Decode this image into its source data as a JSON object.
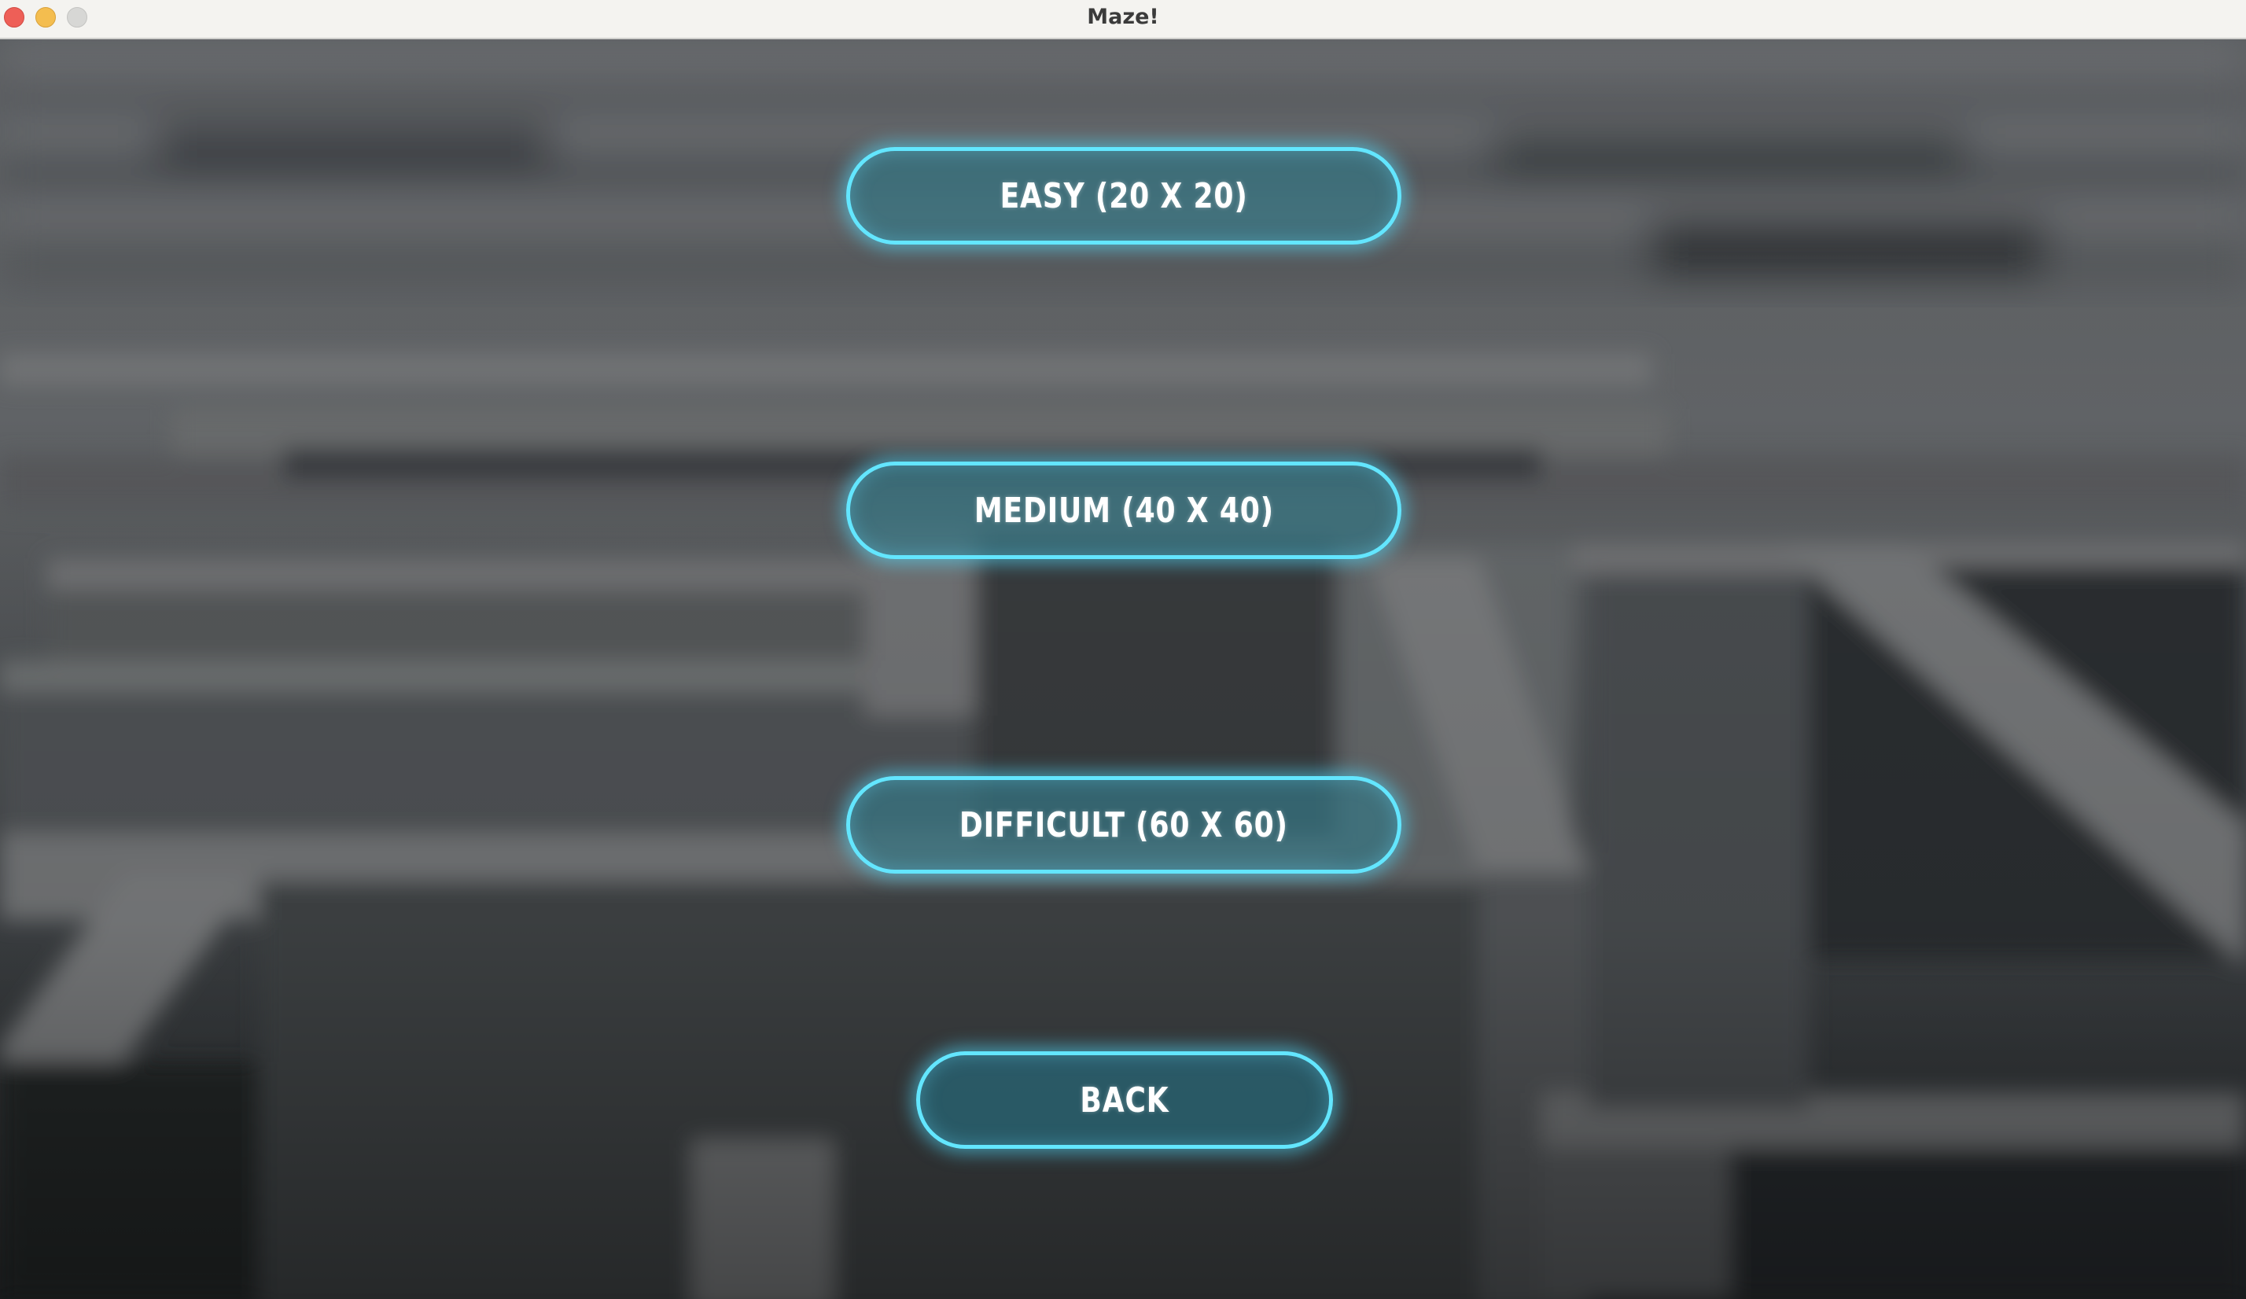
{
  "window": {
    "title": "Maze!"
  },
  "menu": {
    "easy_label": "EASY (20 X 20)",
    "medium_label": "MEDIUM (40 X 40)",
    "difficult_label": "DIFFICULT (60 X 60)",
    "back_label": "BACK"
  },
  "colors": {
    "button_border": "#63e6ff",
    "button_fill": "#367684",
    "label": "#ffffff",
    "titlebar": "#f4f3f0"
  }
}
